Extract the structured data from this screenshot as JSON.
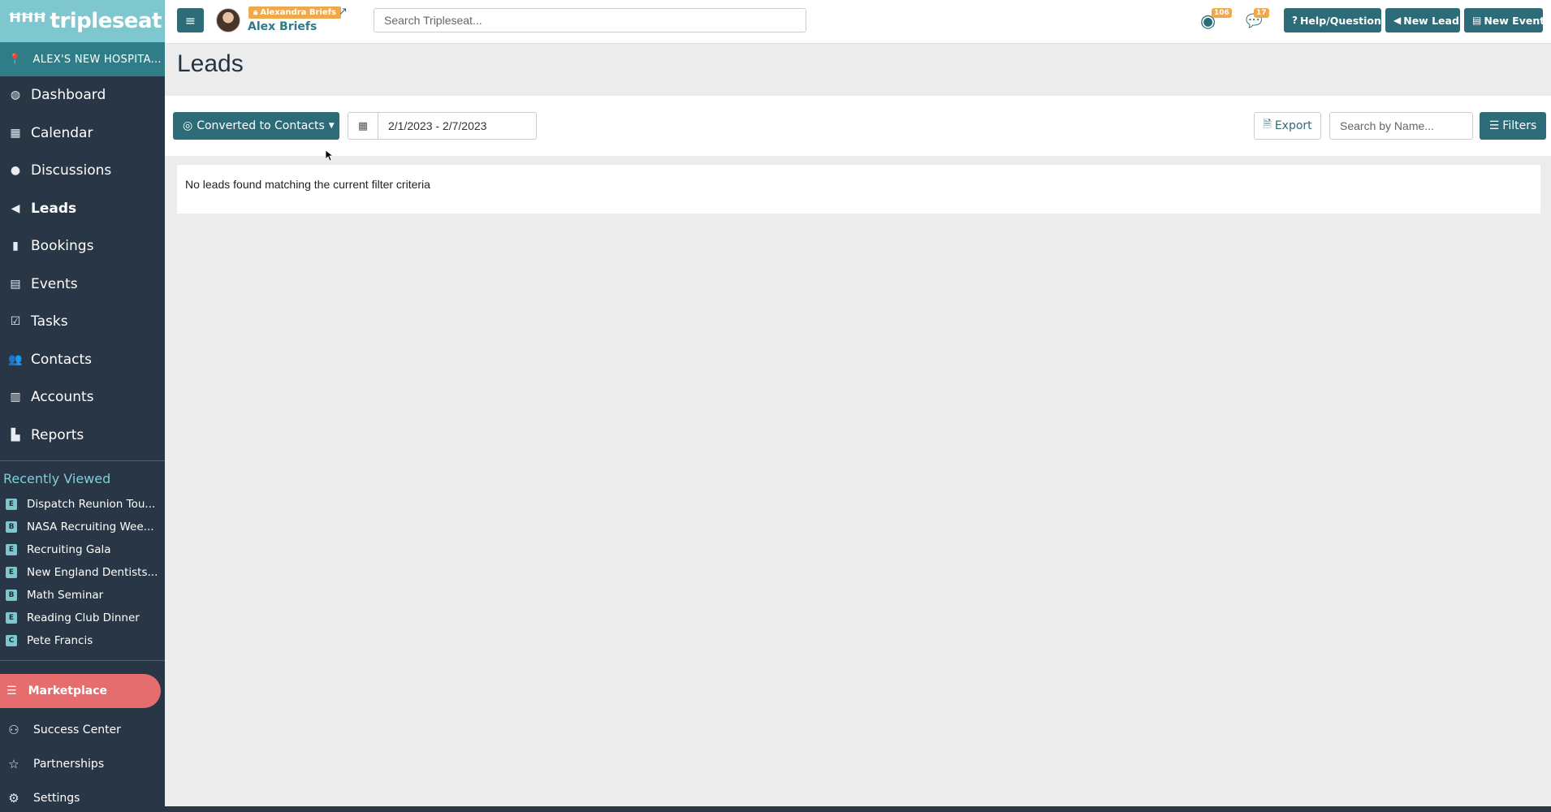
{
  "app": {
    "logo_mark": "ꟸꟸꟸ",
    "logo_text": "tripleseat",
    "location": "ALEX'S NEW HOSPITA..."
  },
  "sidebar": {
    "nav": [
      {
        "label": "Dashboard",
        "icon": "dashboard-icon",
        "glyph": "◍"
      },
      {
        "label": "Calendar",
        "icon": "calendar-icon",
        "glyph": "▦"
      },
      {
        "label": "Discussions",
        "icon": "chat-icon",
        "glyph": "●"
      },
      {
        "label": "Leads",
        "icon": "megaphone-icon",
        "glyph": "◀"
      },
      {
        "label": "Bookings",
        "icon": "bookmark-icon",
        "glyph": "▮"
      },
      {
        "label": "Events",
        "icon": "book-icon",
        "glyph": "▤"
      },
      {
        "label": "Tasks",
        "icon": "checkbox-icon",
        "glyph": "☑"
      },
      {
        "label": "Contacts",
        "icon": "users-icon",
        "glyph": "👥"
      },
      {
        "label": "Accounts",
        "icon": "building-icon",
        "glyph": "▥"
      },
      {
        "label": "Reports",
        "icon": "bar-chart-icon",
        "glyph": "▙"
      }
    ],
    "recent_title": "Recently Viewed",
    "recent": [
      {
        "badge": "E",
        "label": "Dispatch Reunion Tou..."
      },
      {
        "badge": "B",
        "label": "NASA Recruiting Wee..."
      },
      {
        "badge": "E",
        "label": "Recruiting Gala"
      },
      {
        "badge": "E",
        "label": "New England Dentists..."
      },
      {
        "badge": "B",
        "label": "Math Seminar"
      },
      {
        "badge": "E",
        "label": "Reading Club Dinner"
      },
      {
        "badge": "C",
        "label": "Pete Francis"
      }
    ],
    "marketplace": "Marketplace",
    "bottom": [
      {
        "label": "Success Center",
        "icon": "binoculars-icon",
        "glyph": "⚇"
      },
      {
        "label": "Partnerships",
        "icon": "star-icon",
        "glyph": "☆"
      },
      {
        "label": "Settings",
        "icon": "gear-icon",
        "glyph": "⚙"
      }
    ]
  },
  "topbar": {
    "user_tag": "Alexandra Briefs",
    "user_name": "Alex Briefs",
    "search_placeholder": "Search Tripleseat...",
    "notifications_count": "106",
    "messages_count": "17",
    "help_label": "Help/Question",
    "new_lead_label": "New Lead",
    "new_event_label": "New Event"
  },
  "main": {
    "title": "Leads",
    "status_filter": "Converted to Contacts",
    "date_range": "2/1/2023 - 2/7/2023",
    "export_label": "Export",
    "name_search_placeholder": "Search by Name...",
    "filters_label": "Filters",
    "empty_message": "No leads found matching the current filter criteria"
  },
  "colors": {
    "sidebar_bg": "#283645",
    "logo_bg": "#7fc7cf",
    "location_bg": "#2f7d86",
    "primary": "#2e6b78",
    "marketplace": "#e66d6d",
    "badge_orange": "#f0a84a"
  }
}
